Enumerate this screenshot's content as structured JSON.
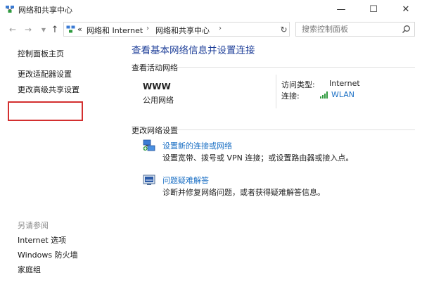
{
  "window": {
    "title": "网络和共享中心",
    "minimize_glyph": "—",
    "maximize_glyph": "☐",
    "close_glyph": "✕"
  },
  "address": {
    "prefix": "«",
    "crumbs": [
      "网络和 Internet",
      "网络和共享中心"
    ],
    "separator": "›",
    "search_placeholder": "搜索控制面板"
  },
  "sidebar": {
    "items": [
      {
        "label": "控制面板主页"
      },
      {
        "label": "更改适配器设置",
        "highlighted": true
      },
      {
        "label": "更改高级共享设置"
      }
    ],
    "see_also_label": "另请参阅",
    "see_also": [
      {
        "label": "Internet 选项"
      },
      {
        "label": "Windows 防火墙"
      },
      {
        "label": "家庭组"
      }
    ]
  },
  "main": {
    "title": "查看基本网络信息并设置连接",
    "active_networks_label": "查看活动网络",
    "network": {
      "name": "WWW",
      "type": "公用网络",
      "access_type_label": "访问类型:",
      "access_type_value": "Internet",
      "connection_label": "连接:",
      "connection_value": "WLAN"
    },
    "change_settings_label": "更改网络设置",
    "tasks": [
      {
        "icon": "network-setup-icon",
        "title": "设置新的连接或网络",
        "desc": "设置宽带、拨号或 VPN 连接；或设置路由器或接入点。"
      },
      {
        "icon": "troubleshoot-icon",
        "title": "问题疑难解答",
        "desc": "诊断并修复网络问题，或者获得疑难解答信息。"
      }
    ]
  },
  "colors": {
    "link_blue": "#1a6fc4",
    "title_blue": "#1e3f99",
    "highlight_red": "#d32f2f"
  }
}
